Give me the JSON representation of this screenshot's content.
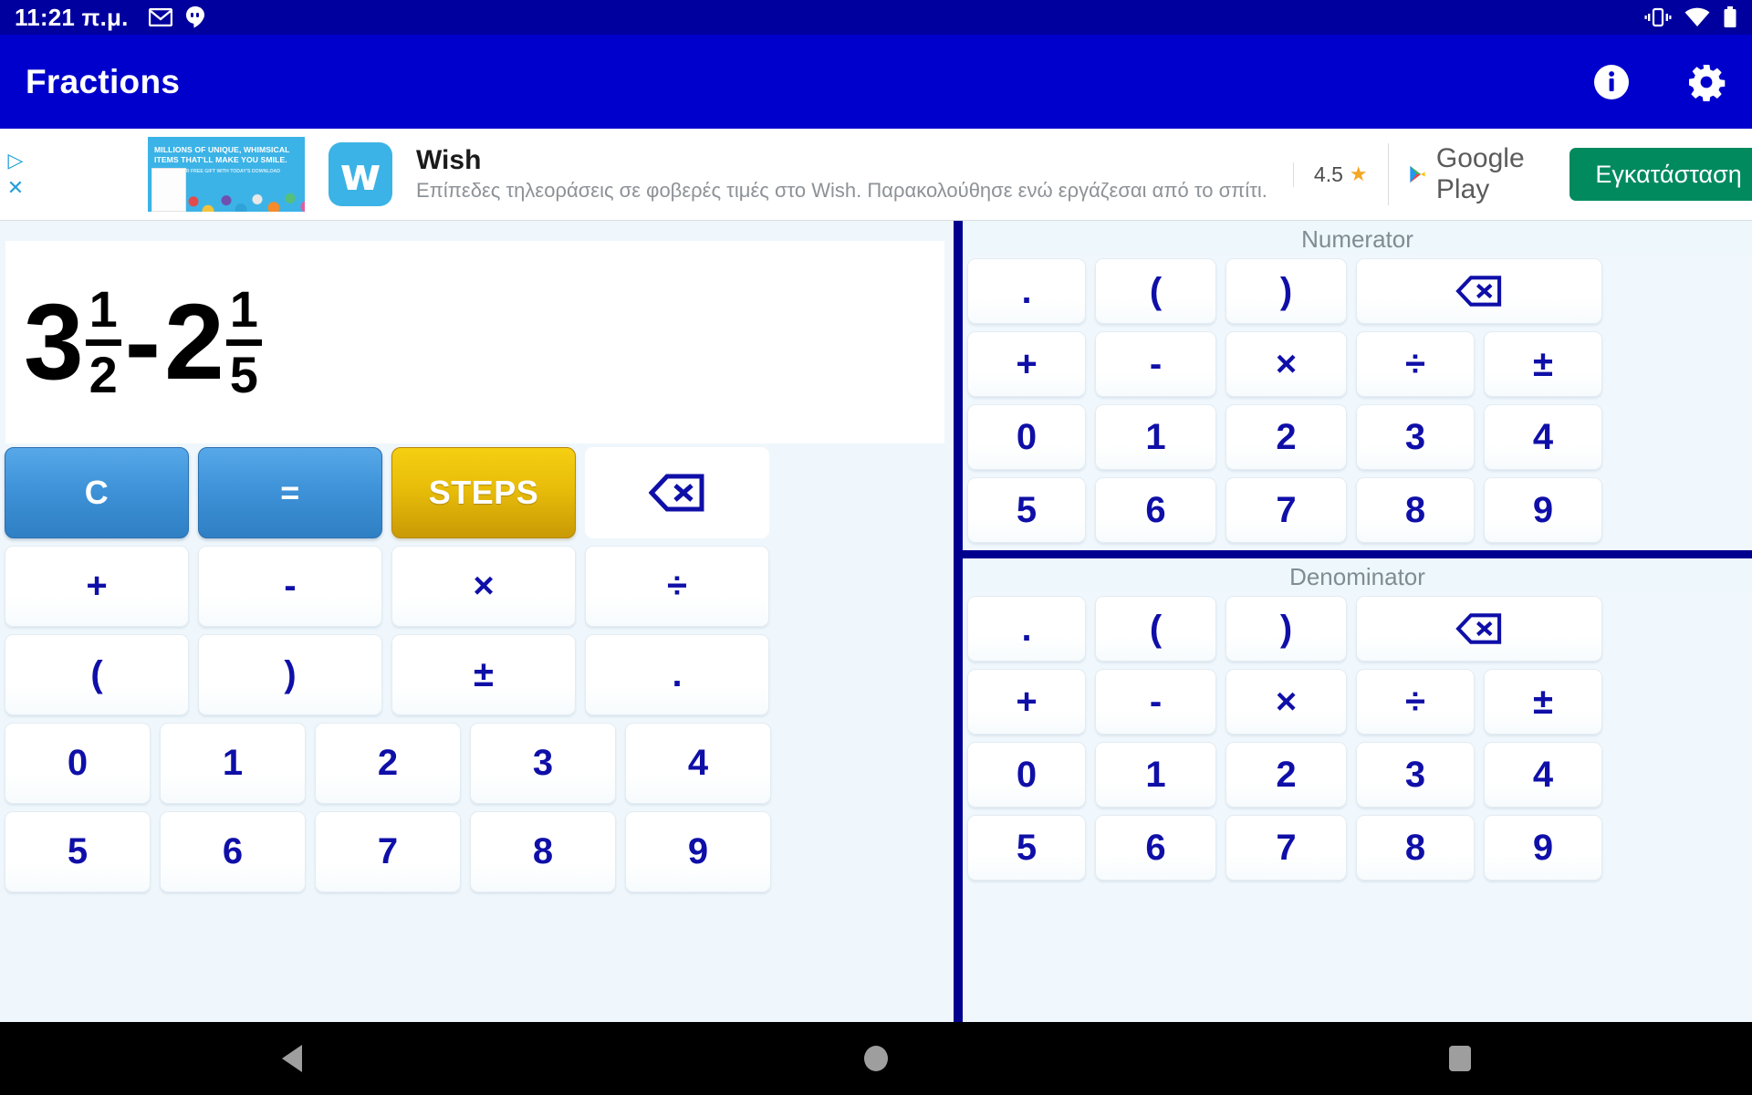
{
  "status_bar": {
    "time": "11:21 π.μ.",
    "left_icons": [
      "gmail-icon",
      "hangouts-icon"
    ],
    "right_icons": [
      "vibrate-icon",
      "wifi-icon",
      "battery-icon"
    ]
  },
  "app_bar": {
    "title": "Fractions",
    "actions": [
      {
        "name": "info-icon",
        "label": "i"
      },
      {
        "name": "settings-gear-icon",
        "label": ""
      }
    ]
  },
  "ad": {
    "image_headline_1": "MILLIONS OF UNIQUE, WHIMSICAL ITEMS THAT'LL MAKE YOU SMILE.",
    "image_headline_2": "UNLOCK YOUR FREE GIFT WITH TODAY'S DOWNLOAD",
    "logo_letter": "w",
    "title": "Wish",
    "subtitle": "Επίπεδες τηλεοράσεις σε φοβερές τιμές στο Wish. Παρακολούθησε ενώ εργάζεσαι από το σπίτι.",
    "rating": "4.5",
    "star": "★",
    "store": "Google Play",
    "install_label": "Εγκατάσταση",
    "install_color": "#008a5e",
    "close_label": "✕",
    "adchoices_label": "▷"
  },
  "display": {
    "term1": {
      "whole": "3",
      "numerator": "1",
      "denominator": "2"
    },
    "operator": "-",
    "term2": {
      "whole": "2",
      "numerator": "1",
      "denominator": "5"
    },
    "expression_text": "3 1/2 - 2 1/5"
  },
  "left_keypad": {
    "actions": [
      {
        "label": "C",
        "style": "action",
        "name": "clear-button"
      },
      {
        "label": "=",
        "style": "action",
        "name": "equals-button"
      },
      {
        "label": "STEPS",
        "style": "steps",
        "name": "steps-button"
      },
      {
        "label": "",
        "style": "backspace",
        "name": "backspace-button"
      }
    ],
    "operators_row1": [
      "+",
      "-",
      "×",
      "÷"
    ],
    "operators_row2": [
      "(",
      ")",
      "±",
      "."
    ],
    "digits_row1": [
      "0",
      "1",
      "2",
      "3",
      "4"
    ],
    "digits_row2": [
      "5",
      "6",
      "7",
      "8",
      "9"
    ]
  },
  "right_keypad": {
    "numerator_label": "Numerator",
    "denominator_label": "Denominator",
    "row_symbols": [
      ".",
      "(",
      ")"
    ],
    "backspace_name": "backspace-button",
    "operators": [
      "+",
      "-",
      "×",
      "÷",
      "±"
    ],
    "digits_row1": [
      "0",
      "1",
      "2",
      "3",
      "4"
    ],
    "digits_row2": [
      "5",
      "6",
      "7",
      "8",
      "9"
    ]
  },
  "nav_bar": {
    "back": "back-button",
    "home": "home-button",
    "recents": "recents-button"
  },
  "colors": {
    "app_bar": "#0000cc",
    "status_bar": "#00009e",
    "key_text": "#0f0fa8",
    "divider": "#00008f",
    "steps": "#e8bd09",
    "action": "#3f93d8"
  }
}
